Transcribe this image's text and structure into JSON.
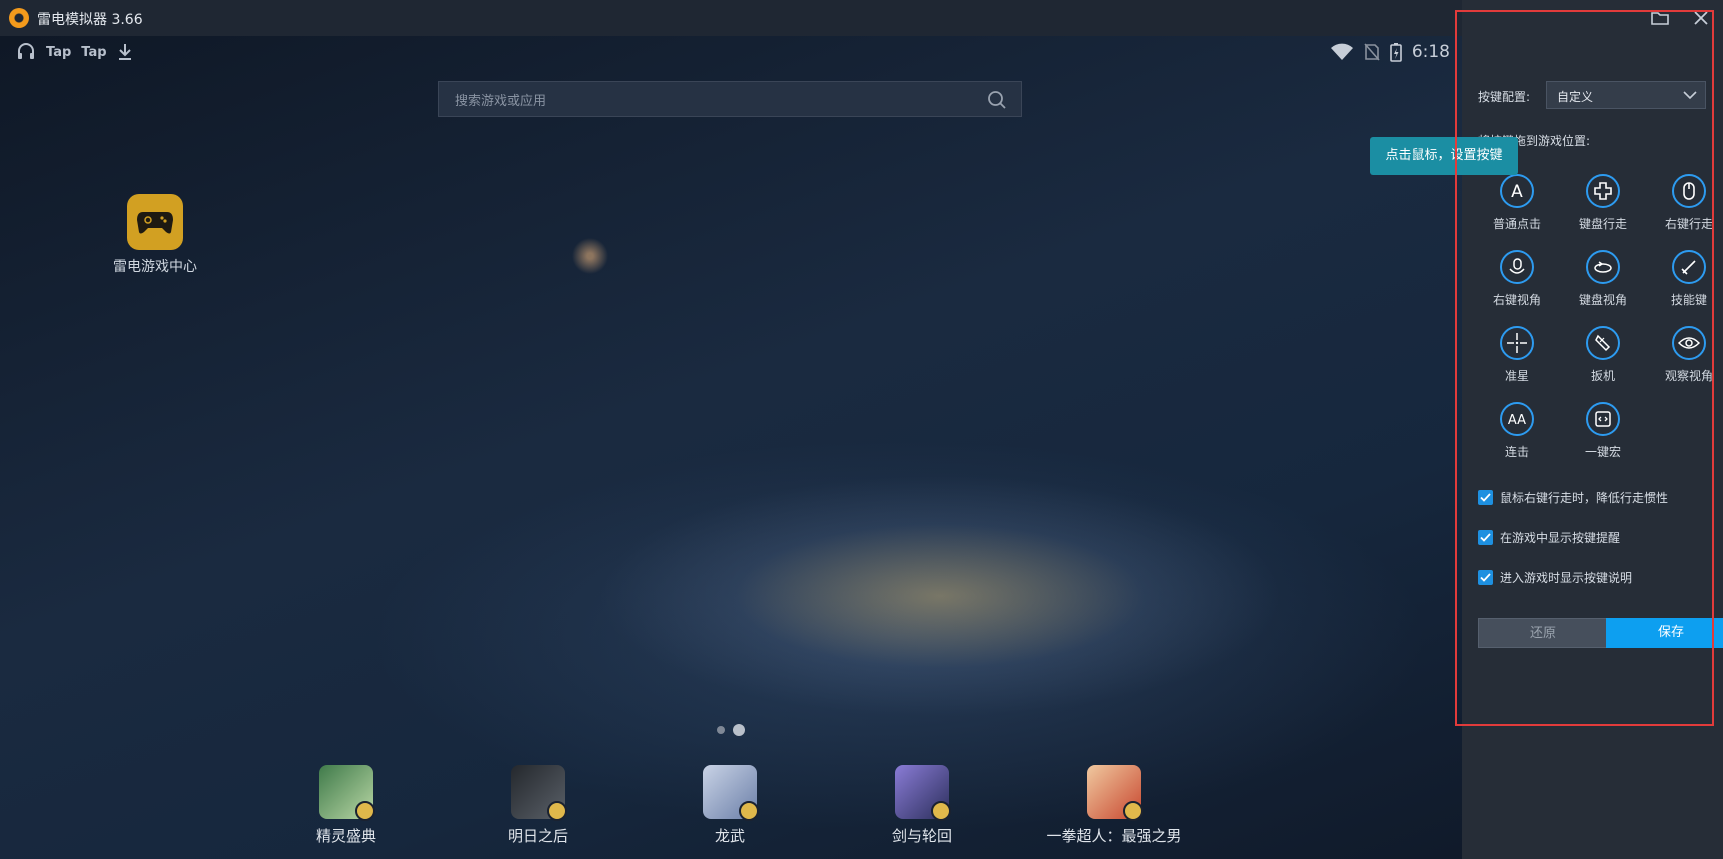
{
  "window": {
    "title": "雷电模拟器 3.66"
  },
  "statusbar": {
    "left_items": [
      "Tap",
      "Tap"
    ],
    "time": "6:18"
  },
  "search": {
    "placeholder": "搜索游戏或应用"
  },
  "desktop": {
    "apps": [
      {
        "label": "雷电游戏中心",
        "icon": "gamepad-icon"
      }
    ]
  },
  "dock": {
    "items": [
      {
        "label": "精灵盛典",
        "color": "#3f7a4a"
      },
      {
        "label": "明日之后",
        "color": "#3b3f45"
      },
      {
        "label": "龙武",
        "color": "#8fa4c4"
      },
      {
        "label": "剑与轮回",
        "color": "#6d5fa6"
      },
      {
        "label": "一拳超人：最强之男",
        "color": "#c8472f"
      }
    ]
  },
  "panel": {
    "config_label": "按键配置:",
    "config_value": "自定义",
    "drag_hint": "将按键拖到游戏位置:",
    "tooltip": "点击鼠标，设置按键",
    "tools": [
      {
        "label": "普通点击",
        "icon": "letter-a-icon"
      },
      {
        "label": "键盘行走",
        "icon": "dpad-icon"
      },
      {
        "label": "右键行走",
        "icon": "mouse-icon"
      },
      {
        "label": "右键视角",
        "icon": "mouse-rotate-icon"
      },
      {
        "label": "键盘视角",
        "icon": "rotate-view-icon"
      },
      {
        "label": "技能键",
        "icon": "sword-icon"
      },
      {
        "label": "准星",
        "icon": "crosshair-icon"
      },
      {
        "label": "扳机",
        "icon": "trigger-icon"
      },
      {
        "label": "观察视角",
        "icon": "eye-icon"
      },
      {
        "label": "连击",
        "icon": "double-a-icon"
      },
      {
        "label": "一键宏",
        "icon": "macro-icon"
      }
    ],
    "options": [
      {
        "label": "鼠标右键行走时，降低行走惯性",
        "checked": true
      },
      {
        "label": "在游戏中显示按键提醒",
        "checked": true
      },
      {
        "label": "进入游戏时显示按键说明",
        "checked": true
      }
    ],
    "reset_label": "还原",
    "save_label": "保存"
  },
  "colors": {
    "accent": "#0d9ff0",
    "highlight_border": "#e23b3b",
    "tooltip_bg": "#1b8ea3"
  }
}
